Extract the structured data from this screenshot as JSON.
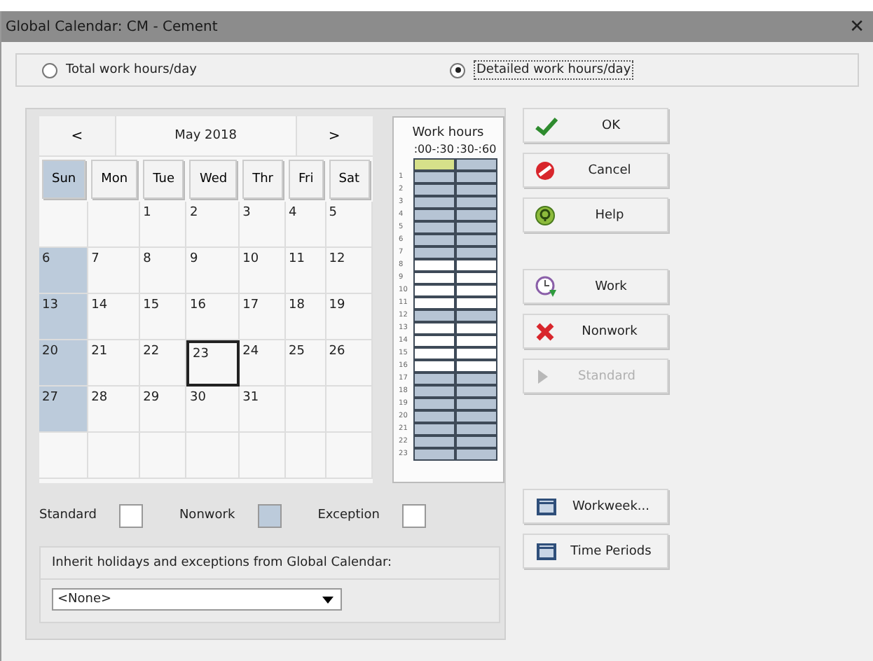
{
  "window": {
    "title": "Global Calendar: CM - Cement",
    "close": "✕"
  },
  "mode_options": [
    {
      "label": "Total work hours/day",
      "selected": false
    },
    {
      "label": "Detailed work hours/day",
      "selected": true
    }
  ],
  "calendar": {
    "prev": "<",
    "month": "May 2018",
    "next": ">",
    "weekdays": [
      {
        "label": "Sun",
        "selected": true
      },
      {
        "label": "Mon",
        "selected": false
      },
      {
        "label": "Tue",
        "selected": false
      },
      {
        "label": "Wed",
        "selected": false
      },
      {
        "label": "Thr",
        "selected": false
      },
      {
        "label": "Fri",
        "selected": false
      },
      {
        "label": "Sat",
        "selected": false
      }
    ],
    "weeks": [
      [
        {
          "nonwork": false,
          "selected": false
        },
        {
          "nonwork": false,
          "selected": false
        },
        {
          "day": "1",
          "nonwork": false,
          "selected": false
        },
        {
          "day": "2",
          "nonwork": false,
          "selected": false
        },
        {
          "day": "3",
          "nonwork": false,
          "selected": false
        },
        {
          "day": "4",
          "nonwork": false,
          "selected": false
        },
        {
          "day": "5",
          "nonwork": false,
          "selected": false
        }
      ],
      [
        {
          "day": "6",
          "nonwork": true,
          "selected": false
        },
        {
          "day": "7",
          "nonwork": false,
          "selected": false
        },
        {
          "day": "8",
          "nonwork": false,
          "selected": false
        },
        {
          "day": "9",
          "nonwork": false,
          "selected": false
        },
        {
          "day": "10",
          "nonwork": false,
          "selected": false
        },
        {
          "day": "11",
          "nonwork": false,
          "selected": false
        },
        {
          "day": "12",
          "nonwork": false,
          "selected": false
        }
      ],
      [
        {
          "day": "13",
          "nonwork": true,
          "selected": false
        },
        {
          "day": "14",
          "nonwork": false,
          "selected": false
        },
        {
          "day": "15",
          "nonwork": false,
          "selected": false
        },
        {
          "day": "16",
          "nonwork": false,
          "selected": false
        },
        {
          "day": "17",
          "nonwork": false,
          "selected": false
        },
        {
          "day": "18",
          "nonwork": false,
          "selected": false
        },
        {
          "day": "19",
          "nonwork": false,
          "selected": false
        }
      ],
      [
        {
          "day": "20",
          "nonwork": true,
          "selected": false
        },
        {
          "day": "21",
          "nonwork": false,
          "selected": false
        },
        {
          "day": "22",
          "nonwork": false,
          "selected": false
        },
        {
          "day": "23",
          "nonwork": false,
          "selected": true
        },
        {
          "day": "24",
          "nonwork": false,
          "selected": false
        },
        {
          "day": "25",
          "nonwork": false,
          "selected": false
        },
        {
          "day": "26",
          "nonwork": false,
          "selected": false
        }
      ],
      [
        {
          "day": "27",
          "nonwork": true,
          "selected": false
        },
        {
          "day": "28",
          "nonwork": false,
          "selected": false
        },
        {
          "day": "29",
          "nonwork": false,
          "selected": false
        },
        {
          "day": "30",
          "nonwork": false,
          "selected": false
        },
        {
          "day": "31",
          "nonwork": false,
          "selected": false
        },
        {
          "nonwork": false,
          "selected": false
        },
        {
          "nonwork": false,
          "selected": false
        }
      ],
      [
        {
          "nonwork": false,
          "selected": false
        },
        {
          "nonwork": false,
          "selected": false
        },
        {
          "nonwork": false,
          "selected": false
        },
        {
          "nonwork": false,
          "selected": false
        },
        {
          "nonwork": false,
          "selected": false
        },
        {
          "nonwork": false,
          "selected": false
        },
        {
          "nonwork": false,
          "selected": false
        }
      ]
    ]
  },
  "legend": [
    {
      "label": "Standard",
      "color": "#ffffff"
    },
    {
      "label": "Nonwork",
      "color": "#bccbdb"
    },
    {
      "label": "Exception",
      "color": "#ffffff"
    }
  ],
  "inherit": {
    "label": "Inherit holidays and exceptions from Global Calendar:",
    "value": "<None>"
  },
  "work_hours": {
    "title": "Work hours",
    "columns": [
      ":00-:30",
      ":30-:60"
    ],
    "rows": [
      {
        "halves": [
          {
            "work": false,
            "selected": true
          },
          {
            "work": false,
            "selected": false
          }
        ]
      },
      {
        "label": "1",
        "halves": [
          {
            "work": false,
            "selected": false
          },
          {
            "work": false,
            "selected": false
          }
        ]
      },
      {
        "label": "2",
        "halves": [
          {
            "work": false,
            "selected": false
          },
          {
            "work": false,
            "selected": false
          }
        ]
      },
      {
        "label": "3",
        "halves": [
          {
            "work": false,
            "selected": false
          },
          {
            "work": false,
            "selected": false
          }
        ]
      },
      {
        "label": "4",
        "halves": [
          {
            "work": false,
            "selected": false
          },
          {
            "work": false,
            "selected": false
          }
        ]
      },
      {
        "label": "5",
        "halves": [
          {
            "work": false,
            "selected": false
          },
          {
            "work": false,
            "selected": false
          }
        ]
      },
      {
        "label": "6",
        "halves": [
          {
            "work": false,
            "selected": false
          },
          {
            "work": false,
            "selected": false
          }
        ]
      },
      {
        "label": "7",
        "halves": [
          {
            "work": false,
            "selected": false
          },
          {
            "work": false,
            "selected": false
          }
        ]
      },
      {
        "label": "8",
        "halves": [
          {
            "work": true,
            "selected": false
          },
          {
            "work": true,
            "selected": false
          }
        ]
      },
      {
        "label": "9",
        "halves": [
          {
            "work": true,
            "selected": false
          },
          {
            "work": true,
            "selected": false
          }
        ]
      },
      {
        "label": "10",
        "halves": [
          {
            "work": true,
            "selected": false
          },
          {
            "work": true,
            "selected": false
          }
        ]
      },
      {
        "label": "11",
        "halves": [
          {
            "work": true,
            "selected": false
          },
          {
            "work": true,
            "selected": false
          }
        ]
      },
      {
        "label": "12",
        "halves": [
          {
            "work": false,
            "selected": false
          },
          {
            "work": false,
            "selected": false
          }
        ]
      },
      {
        "label": "13",
        "halves": [
          {
            "work": true,
            "selected": false
          },
          {
            "work": true,
            "selected": false
          }
        ]
      },
      {
        "label": "14",
        "halves": [
          {
            "work": true,
            "selected": false
          },
          {
            "work": true,
            "selected": false
          }
        ]
      },
      {
        "label": "15",
        "halves": [
          {
            "work": true,
            "selected": false
          },
          {
            "work": true,
            "selected": false
          }
        ]
      },
      {
        "label": "16",
        "halves": [
          {
            "work": true,
            "selected": false
          },
          {
            "work": true,
            "selected": false
          }
        ]
      },
      {
        "label": "17",
        "halves": [
          {
            "work": false,
            "selected": false
          },
          {
            "work": false,
            "selected": false
          }
        ]
      },
      {
        "label": "18",
        "halves": [
          {
            "work": false,
            "selected": false
          },
          {
            "work": false,
            "selected": false
          }
        ]
      },
      {
        "label": "19",
        "halves": [
          {
            "work": false,
            "selected": false
          },
          {
            "work": false,
            "selected": false
          }
        ]
      },
      {
        "label": "20",
        "halves": [
          {
            "work": false,
            "selected": false
          },
          {
            "work": false,
            "selected": false
          }
        ]
      },
      {
        "label": "21",
        "halves": [
          {
            "work": false,
            "selected": false
          },
          {
            "work": false,
            "selected": false
          }
        ]
      },
      {
        "label": "22",
        "halves": [
          {
            "work": false,
            "selected": false
          },
          {
            "work": false,
            "selected": false
          }
        ]
      },
      {
        "label": "23",
        "halves": [
          {
            "work": false,
            "selected": false
          },
          {
            "work": false,
            "selected": false
          }
        ]
      }
    ]
  },
  "button_groups": [
    [
      {
        "label": "OK",
        "kind": "check",
        "disabled": false
      },
      {
        "label": "Cancel",
        "kind": "cancel",
        "disabled": false
      },
      {
        "label": "Help",
        "kind": "help",
        "disabled": false
      }
    ],
    [
      {
        "label": "Work",
        "kind": "work",
        "disabled": false
      },
      {
        "label": "Nonwork",
        "kind": "nonwork",
        "disabled": false
      },
      {
        "label": "Standard",
        "kind": "standard",
        "disabled": true
      }
    ],
    [
      {
        "label": "Workweek...",
        "kind": "calendar",
        "disabled": false
      },
      {
        "label": "Time Periods",
        "kind": "calendar",
        "disabled": false
      }
    ]
  ]
}
